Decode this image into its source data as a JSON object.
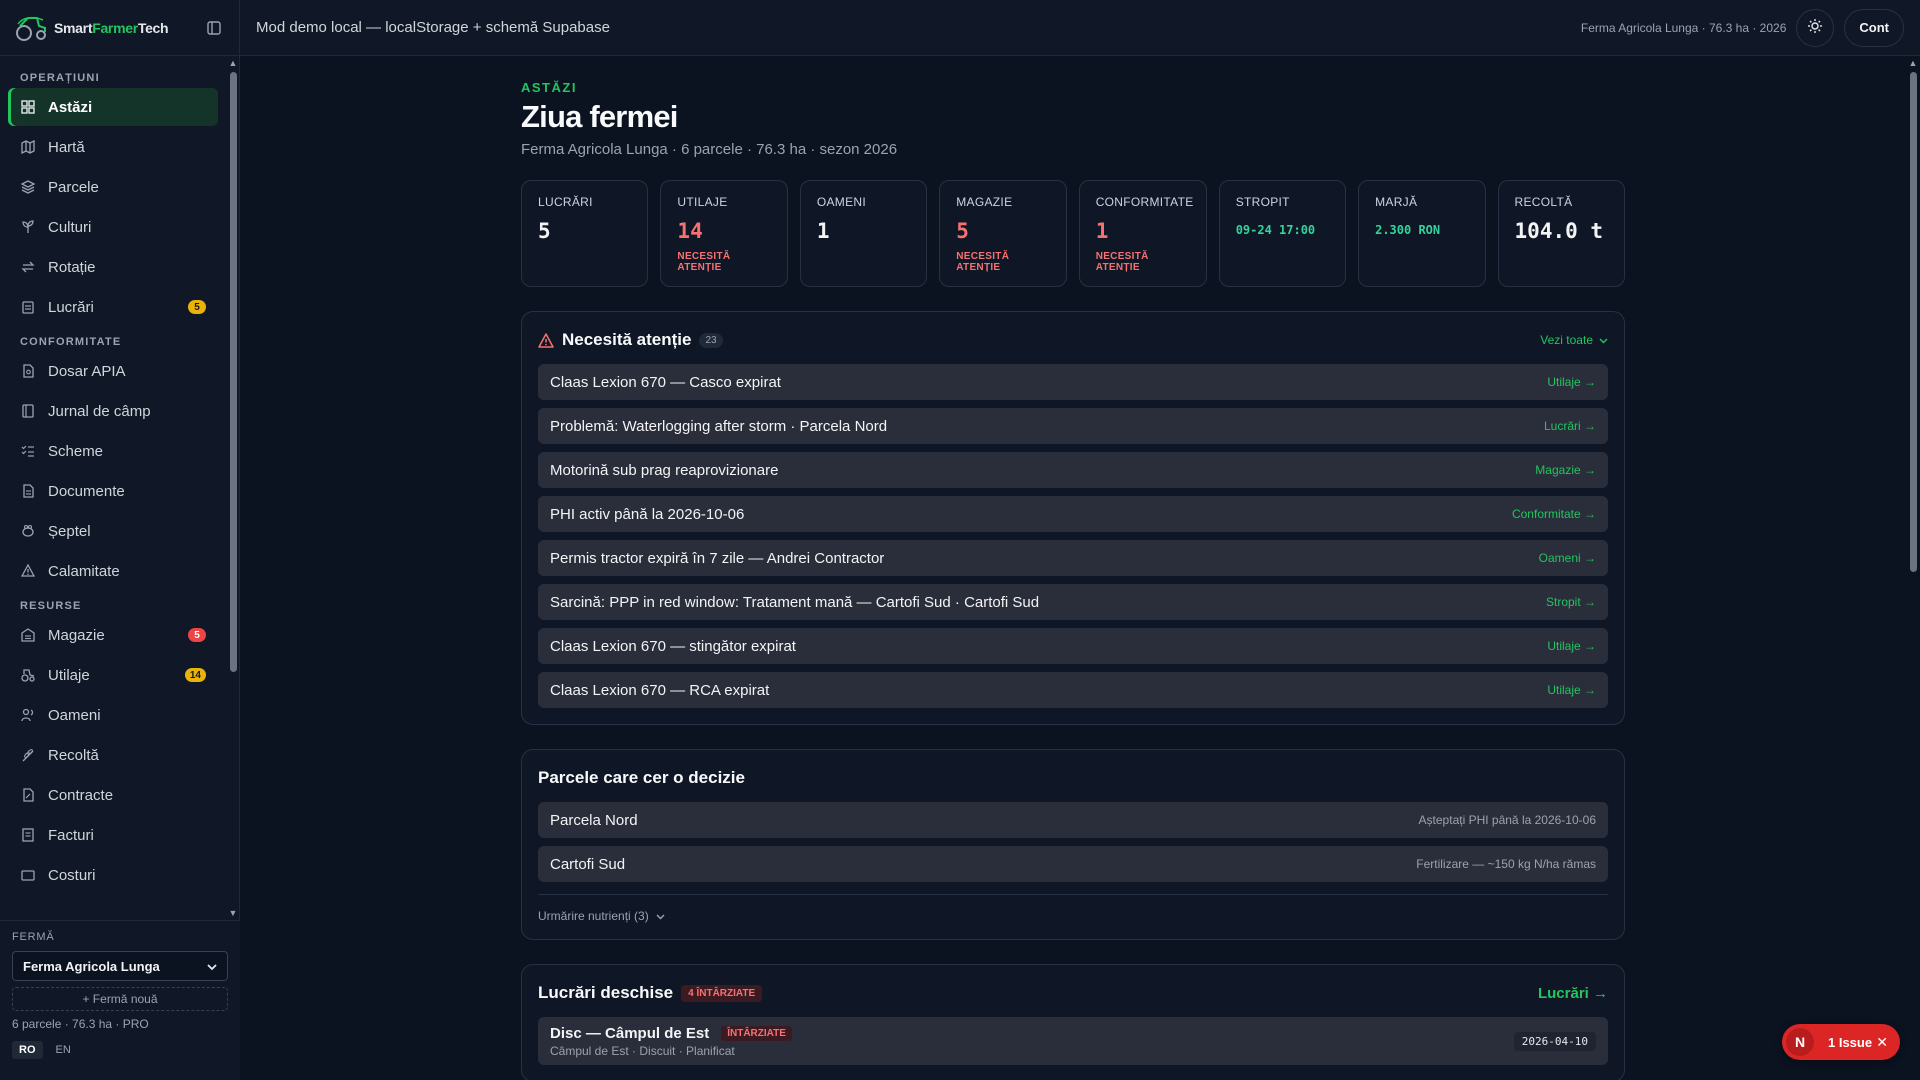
{
  "brand": {
    "name_a": "Smart",
    "name_b": "Farmer",
    "name_c": "Tech"
  },
  "topbar": {
    "title": "Mod demo local — localStorage + schemă Supabase",
    "farm_info": "Ferma Agricola Lunga · 76.3 ha · 2026",
    "account_label": "Cont"
  },
  "sidebar": {
    "sections": [
      {
        "label": "OPERAȚIUNI"
      },
      {
        "label": "CONFORMITATE"
      },
      {
        "label": "RESURSE"
      }
    ],
    "items": [
      {
        "label": "Astăzi",
        "icon": "grid-icon"
      },
      {
        "label": "Hartă",
        "icon": "map-icon"
      },
      {
        "label": "Parcele",
        "icon": "layers-icon"
      },
      {
        "label": "Culturi",
        "icon": "sprout-icon"
      },
      {
        "label": "Rotație",
        "icon": "rotate-icon"
      },
      {
        "label": "Lucrări",
        "icon": "clipboard-icon",
        "badge": "5"
      },
      {
        "label": "Dosar APIA",
        "icon": "file-icon"
      },
      {
        "label": "Jurnal de câmp",
        "icon": "notebook-icon"
      },
      {
        "label": "Scheme",
        "icon": "list-check-icon"
      },
      {
        "label": "Documente",
        "icon": "document-icon"
      },
      {
        "label": "Șeptel",
        "icon": "animal-icon"
      },
      {
        "label": "Calamitate",
        "icon": "warning-icon"
      },
      {
        "label": "Magazie",
        "icon": "warehouse-icon",
        "badge": "5"
      },
      {
        "label": "Utilaje",
        "icon": "tractor-icon",
        "badge": "14"
      },
      {
        "label": "Oameni",
        "icon": "users-icon"
      },
      {
        "label": "Recoltă",
        "icon": "wheat-icon"
      },
      {
        "label": "Contracte",
        "icon": "contract-icon"
      },
      {
        "label": "Facturi",
        "icon": "invoice-icon"
      },
      {
        "label": "Costuri",
        "icon": "cost-icon"
      }
    ],
    "farm": {
      "label": "FERMĂ",
      "selected": "Ferma Agricola Lunga",
      "new_farm": "+ Fermă nouă",
      "meta": "6 parcele · 76.3 ha · PRO",
      "lang_ro": "RO",
      "lang_en": "EN"
    }
  },
  "page": {
    "eyebrow": "ASTĂZI",
    "title": "Ziua fermei",
    "subtitle": "Ferma Agricola Lunga · 6 parcele · 76.3 ha · sezon 2026"
  },
  "kpis": [
    {
      "label": "LUCRĂRI",
      "value": "5"
    },
    {
      "label": "UTILAJE",
      "value": "14",
      "note": "NECESITĂ ATENȚIE"
    },
    {
      "label": "OAMENI",
      "value": "1"
    },
    {
      "label": "MAGAZIE",
      "value": "5",
      "note": "NECESITĂ ATENȚIE"
    },
    {
      "label": "CONFORMITATE",
      "value": "1",
      "note": "NECESITĂ ATENȚIE"
    },
    {
      "label": "STROPIT",
      "value": "09-24 17:00"
    },
    {
      "label": "MARJĂ",
      "value": "2.300 RON"
    },
    {
      "label": "RECOLTĂ",
      "value": "104.0 t"
    }
  ],
  "attention": {
    "title": "Necesită atenție",
    "count": "23",
    "see_all": "Vezi toate",
    "items": [
      {
        "text": "Claas Lexion 670 — Casco expirat",
        "link": "Utilaje →"
      },
      {
        "text": "Problemă: Waterlogging after storm · Parcela Nord",
        "link": "Lucrări →"
      },
      {
        "text": "Motorină sub prag reaprovizionare",
        "link": "Magazie →"
      },
      {
        "text": "PHI activ până la 2026-10-06",
        "link": "Conformitate →"
      },
      {
        "text": "Permis tractor expiră în 7 zile — Andrei Contractor",
        "link": "Oameni →"
      },
      {
        "text": "Sarcină: PPP in red window: Tratament mană — Cartofi Sud · Cartofi Sud",
        "link": "Stropit →"
      },
      {
        "text": "Claas Lexion 670 — stingător expirat",
        "link": "Utilaje →"
      },
      {
        "text": "Claas Lexion 670 — RCA expirat",
        "link": "Utilaje →"
      }
    ]
  },
  "decisions": {
    "title": "Parcele care cer o decizie",
    "items": [
      {
        "text": "Parcela Nord",
        "note": "Așteptați PHI până la 2026-10-06"
      },
      {
        "text": "Cartofi Sud",
        "note": "Fertilizare — ~150 kg N/ha rămas"
      }
    ],
    "toggle": "Urmărire nutrienți (3)"
  },
  "open_work": {
    "title": "Lucrări deschise",
    "late_badge": "4 ÎNTÂRZIATE",
    "link": "Lucrări →",
    "items": [
      {
        "title": "Disc — Câmpul de Est",
        "badge": "ÎNTÂRZIATE",
        "sub": "Câmpul de Est · Discuit · Planificat",
        "date": "2026-04-10"
      }
    ]
  },
  "issue_toast": {
    "initial": "N",
    "text": "1 Issue"
  }
}
